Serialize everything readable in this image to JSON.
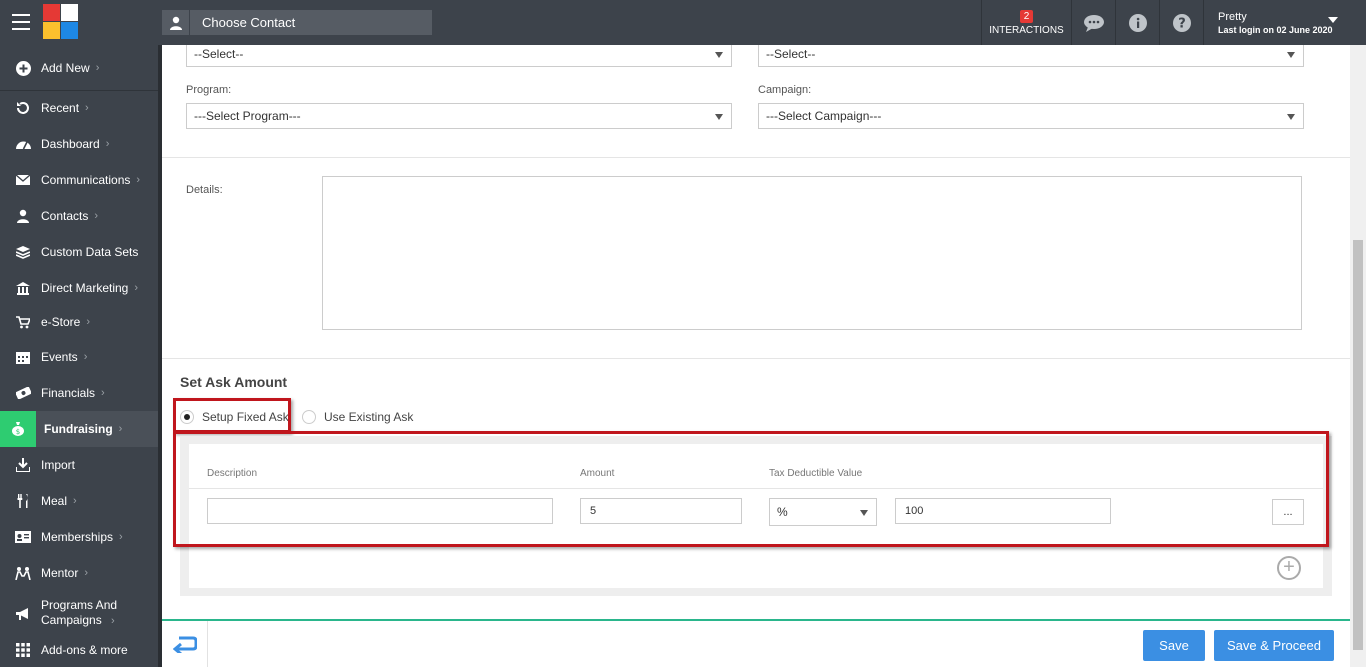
{
  "header": {
    "contact_chooser_label": "Choose Contact",
    "interactions_count": "2",
    "interactions_label": "INTERACTIONS",
    "user_name": "Pretty",
    "last_login": "Last login on 02 June 2020"
  },
  "sidebar": {
    "add_new": "Add New",
    "items": [
      {
        "label": "Recent",
        "icon": "history-icon"
      },
      {
        "label": "Dashboard",
        "icon": "dashboard-icon"
      },
      {
        "label": "Communications",
        "icon": "envelope-icon"
      },
      {
        "label": "Contacts",
        "icon": "person-icon"
      },
      {
        "label": "Custom Data Sets",
        "icon": "layers-icon"
      },
      {
        "label": "Direct Marketing",
        "icon": "bank-icon"
      },
      {
        "label": "e-Store",
        "icon": "cart-icon"
      },
      {
        "label": "Events",
        "icon": "calendar-icon"
      },
      {
        "label": "Financials",
        "icon": "money-icon"
      },
      {
        "label": "Fundraising",
        "icon": "moneybag-icon"
      },
      {
        "label": "Import",
        "icon": "import-icon"
      },
      {
        "label": "Meal",
        "icon": "cutlery-icon"
      },
      {
        "label": "Memberships",
        "icon": "id-card-icon"
      },
      {
        "label": "Mentor",
        "icon": "people-icon"
      },
      {
        "label": "Programs And",
        "label2": "Campaigns",
        "icon": "megaphone-icon"
      },
      {
        "label": "Add-ons & more",
        "icon": "grid-icon"
      }
    ]
  },
  "form": {
    "select1_value": "--Select--",
    "select2_value": "--Select--",
    "program_label": "Program:",
    "program_value": "---Select Program---",
    "campaign_label": "Campaign:",
    "campaign_value": "---Select Campaign---",
    "details_label": "Details:",
    "set_ask_title": "Set Ask Amount",
    "radio_fixed": "Setup Fixed Ask",
    "radio_existing": "Use Existing Ask",
    "col_description": "Description",
    "col_amount": "Amount",
    "col_tax": "Tax Deductible Value",
    "description_value": "",
    "amount_value": "5",
    "tax_type_value": "%",
    "tax_value": "100",
    "more_button": "..."
  },
  "footer": {
    "save": "Save",
    "save_proceed": "Save & Proceed"
  },
  "colors": {
    "accent_green": "#2ecc71",
    "button_blue": "#3b8fe3",
    "highlight_red": "#c0161d",
    "topbar": "#3d434b"
  }
}
